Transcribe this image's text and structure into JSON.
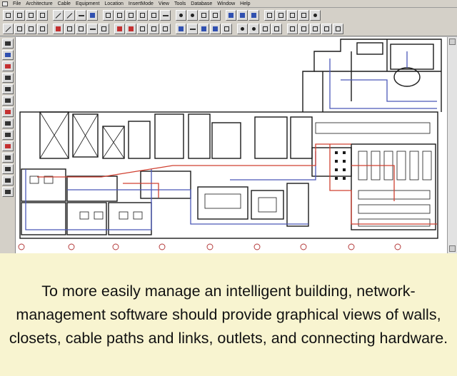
{
  "menu": {
    "items": [
      "File",
      "Architecture",
      "Cable",
      "Equipment",
      "Location",
      "InsertMode",
      "View",
      "Tools",
      "Database",
      "Window",
      "Help"
    ]
  },
  "toolbar": {
    "row1_icons": [
      "new-file-icon",
      "open-icon",
      "save-icon",
      "print-icon",
      "line-tool-icon",
      "arc-tool-icon",
      "text-tool-icon",
      "select-icon",
      "grid-icon",
      "move-icon",
      "layer-icon",
      "cable-icon",
      "zoom-icon",
      "help-icon"
    ],
    "row2_icons": [
      "pointer-icon",
      "rectangle-icon",
      "polyline-icon",
      "text-icon",
      "outlet-icon",
      "closet-icon",
      "rack-icon",
      "patch-panel-icon",
      "cable-path-icon",
      "route-icon",
      "measure-icon",
      "arrow-up-icon",
      "arrow-down-icon",
      "zoom-in-icon",
      "zoom-out-icon",
      "refresh-icon"
    ]
  },
  "palette": {
    "icons": [
      "select-icon",
      "wall-icon",
      "door-icon",
      "window-icon",
      "room-icon",
      "closet-icon",
      "outlet-icon",
      "cable-icon",
      "tray-icon",
      "rack-icon",
      "label-icon",
      "dimension-icon",
      "layer-icon",
      "delete-icon"
    ]
  },
  "canvas": {
    "content": "floor-plan"
  },
  "colors": {
    "cable_path_blue": "#4a58b8",
    "cable_link_red": "#d04030",
    "plan_line": "#1a1a1a",
    "caption_bg": "#f8f4d0"
  },
  "caption": {
    "text": "To more easily manage an intelligent building, network-management software should provide graphical views of walls, closets, cable paths and links, outlets, and connecting hardware."
  }
}
